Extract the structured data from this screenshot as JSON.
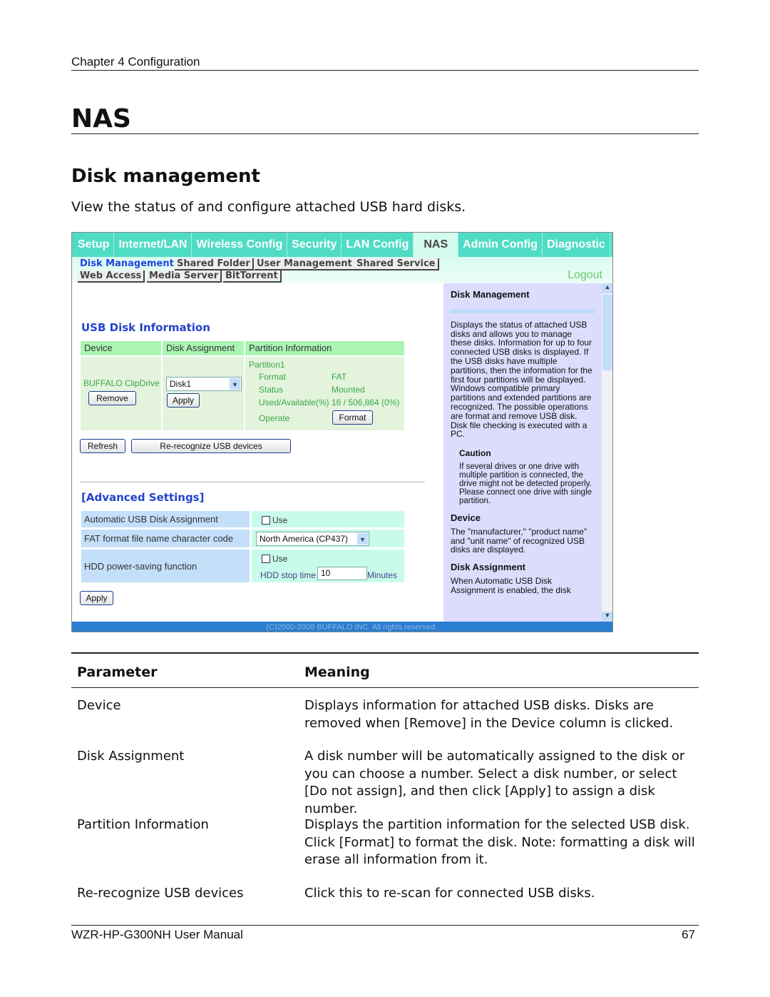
{
  "header": {
    "chapter": "Chapter 4  Configuration"
  },
  "title": "NAS",
  "section": {
    "heading": "Disk management",
    "description": "View the status of and configure attached USB hard disks."
  },
  "screenshot": {
    "tabs": [
      "Setup",
      "Internet/LAN",
      "Wireless Config",
      "Security",
      "LAN Config",
      "NAS",
      "Admin Config",
      "Diagnostic"
    ],
    "active_tab": "NAS",
    "subtabs": [
      "Disk Management",
      "Shared Folder",
      "User Management",
      "Shared Service",
      "Web Access",
      "Media Server",
      "BitTorrent"
    ],
    "logout": "Logout",
    "usb_heading": "USB Disk Information",
    "cols": [
      "Device",
      "Disk Assignment",
      "Partition Information"
    ],
    "device_name": "BUFFALO ClipDrive",
    "remove": "Remove",
    "disk_select": "Disk1",
    "apply": "Apply",
    "partition": {
      "name": "Partition1",
      "format_label": "Format",
      "format_value": "FAT",
      "status_label": "Status",
      "status_value": "Mounted",
      "used_label": "Used/Available(%)",
      "used_value": "16 / 506,864 (0%)",
      "operate_label": "Operate",
      "format_button": "Format"
    },
    "refresh": "Refresh",
    "rerecognize": "Re-recognize USB devices",
    "advanced_heading": "[Advanced Settings]",
    "adv": {
      "auto_label": "Automatic USB Disk Assignment",
      "use": "Use",
      "fat_label": "FAT format file name character code",
      "fat_value": "North America (CP437)",
      "hdd_label": "HDD power-saving function",
      "stop_label": "HDD stop time",
      "stop_value": "10",
      "minutes": "Minutes"
    },
    "apply2": "Apply",
    "help": {
      "h1": "Disk Management",
      "p1": "Displays the status of attached USB disks and allows you to manage these disks. Information for up to four connected USB disks is displayed. If the USB disks have multiple partitions, then the information for the first four partitions will be displayed. Windows compatible primary partitions and extended partitions are recognized. The possible operations are format and remove USB disk. Disk file checking is executed with a PC.",
      "caution_h": "Caution",
      "caution": "If several drives or one drive with multiple partition is connected, the drive might not be detected properly. Please connect one drive with single partition.",
      "device_h": "Device",
      "device": "The \"manufacturer,\" \"product name\" and \"unit name\" of recognized USB disks are displayed.",
      "assign_h": "Disk Assignment",
      "assign": "When Automatic USB Disk Assignment is enabled, the disk"
    },
    "copyright": "(C)2000-2009 BUFFALO INC. All rights reserved."
  },
  "table": {
    "headers": [
      "Parameter",
      "Meaning"
    ],
    "rows": [
      {
        "param": "Device",
        "meaning": "Displays information for attached USB disks.  Disks are removed when [Remove] in the Device column is clicked."
      },
      {
        "param": "Disk Assignment",
        "meaning": "A disk number will be automatically assigned to the disk or you can choose a number.  Select a disk number, or select [Do not assign], and then click [Apply] to assign a disk number."
      },
      {
        "param": "Partition Information",
        "meaning": "Displays the partition information for the selected USB disk.  Click [Format] to format the disk.  Note:  formatting a disk will erase all information from it."
      },
      {
        "param": "Re-recognize USB devices",
        "meaning": "Click this to re-scan for connected USB disks."
      }
    ]
  },
  "footer": {
    "manual": "WZR-HP-G300NH User Manual",
    "page": "67"
  }
}
